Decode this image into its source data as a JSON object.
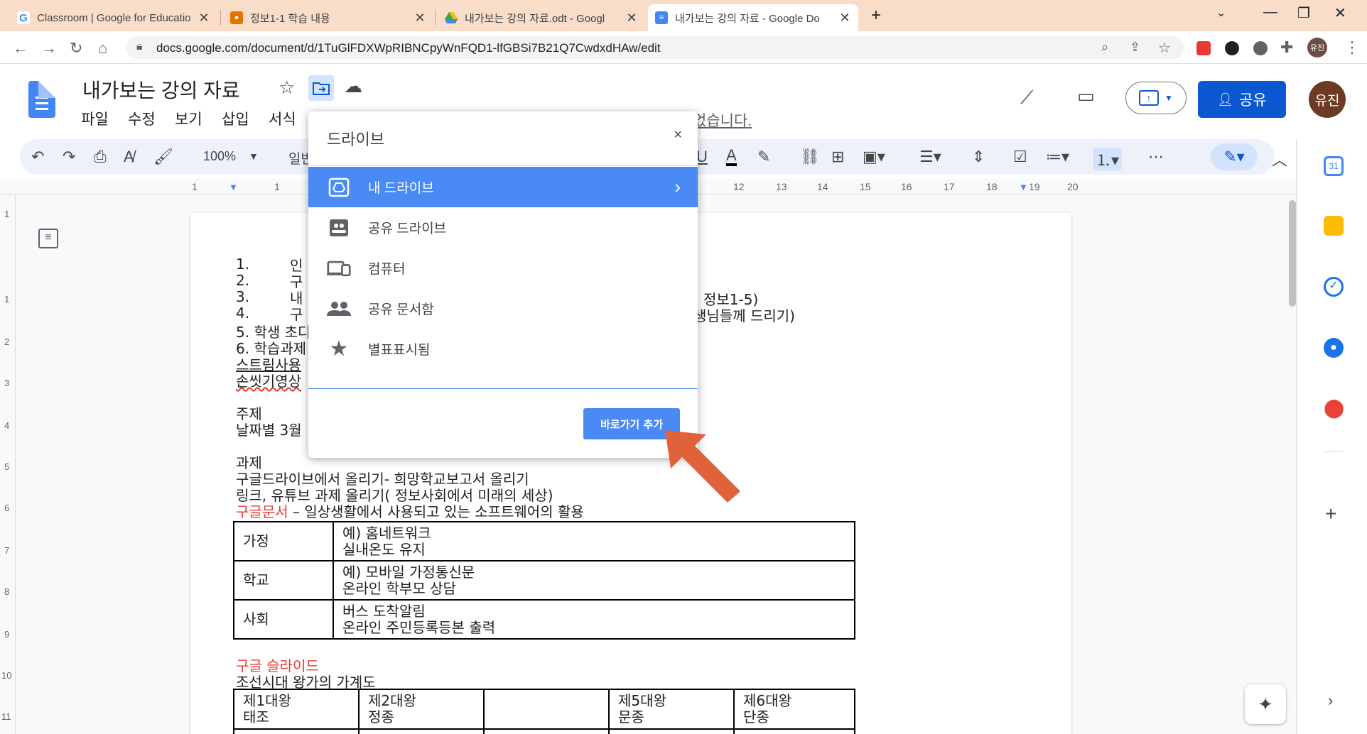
{
  "browser": {
    "tabs": [
      {
        "title": "Classroom | Google for Educatio",
        "favicon": "google-g-icon",
        "active": false
      },
      {
        "title": "정보1-1 학습 내용",
        "favicon": "classroom-icon",
        "active": false
      },
      {
        "title": "내가보는 강의 자료.odt - Googl",
        "favicon": "drive-icon",
        "active": false
      },
      {
        "title": "내가보는 강의 자료 - Google Do",
        "favicon": "docs-icon",
        "active": true
      }
    ],
    "new_tab": "+",
    "url": "docs.google.com/document/d/1TuGlFDXWpRIBNCpyWnFQD1-lfGBSi7B21Q7CwdxdHAw/edit",
    "profile_initials": "유진"
  },
  "docs": {
    "title": "내가보는 강의 자료",
    "menus": [
      "파일",
      "수정",
      "보기",
      "삽입",
      "서식"
    ],
    "last_edit": "었습니다.",
    "share_label": "공유",
    "avatar": "유진",
    "zoom": "100%",
    "style": "일반",
    "ruler_numbers": [
      "1",
      "1",
      "12",
      "13",
      "14",
      "15",
      "16",
      "17",
      "18",
      "19",
      "20"
    ],
    "vruler_numbers": [
      "1",
      "1",
      "2",
      "3",
      "4",
      "5",
      "6",
      "7",
      "8",
      "9",
      "10",
      "11"
    ]
  },
  "document": {
    "lines": [
      "1.",
      "2.",
      "3.",
      "4.",
      "5. 학생 초디",
      "6. 학습과제",
      "스트림사용",
      "손씻기영상"
    ],
    "partial": [
      "인",
      "구",
      "내",
      "구"
    ],
    "right_fragments": [
      "정보1-5)",
      "생님들께 드리기)"
    ],
    "topic_label": "주제",
    "topic_line": "날짜별 3월",
    "task_label": "과제",
    "task1": "구글드라이브에서 올리기- 희망학교보고서 올리기",
    "task2": "링크, 유튜브 과제 올리기( 정보사회에서 미래의 세상)",
    "task3_red": "구글문서",
    "task3_rest": " – 일상생활에서 사용되고 있는 소프트웨어의 활용",
    "table1": [
      {
        "label": "가정",
        "l1": "예) 홈네트워크",
        "l2": "실내온도 유지"
      },
      {
        "label": "학교",
        "l1": "예) 모바일 가정통신문",
        "l2": "온라인 학부모 상담"
      },
      {
        "label": "사회",
        "l1": "버스 도착알림",
        "l2": "온라인 주민등록등본 출력"
      }
    ],
    "slides_red": "구글 슬라이드",
    "slides_line": "조선시대 왕가의 가계도",
    "table2": [
      {
        "l1": "제1대왕",
        "l2": "태조"
      },
      {
        "l1": "제2대왕",
        "l2": "정종"
      },
      {
        "l1": "",
        "l2": ""
      },
      {
        "l1": "제5대왕",
        "l2": "문종"
      },
      {
        "l1": "제6대왕",
        "l2": "단종"
      }
    ]
  },
  "dialog": {
    "title": "드라이브",
    "close": "×",
    "items": [
      {
        "label": "내 드라이브",
        "icon": "drive-icon",
        "selected": true
      },
      {
        "label": "공유 드라이브",
        "icon": "shared-drive-icon",
        "selected": false
      },
      {
        "label": "컴퓨터",
        "icon": "computer-icon",
        "selected": false
      },
      {
        "label": "공유 문서함",
        "icon": "people-icon",
        "selected": false
      },
      {
        "label": "별표표시됨",
        "icon": "star-icon",
        "selected": false
      }
    ],
    "button": "바로가기 추가"
  },
  "colors": {
    "accent": "#4a8af4",
    "arrow": "#e0623c",
    "tabstrip": "#f9ddc9"
  }
}
